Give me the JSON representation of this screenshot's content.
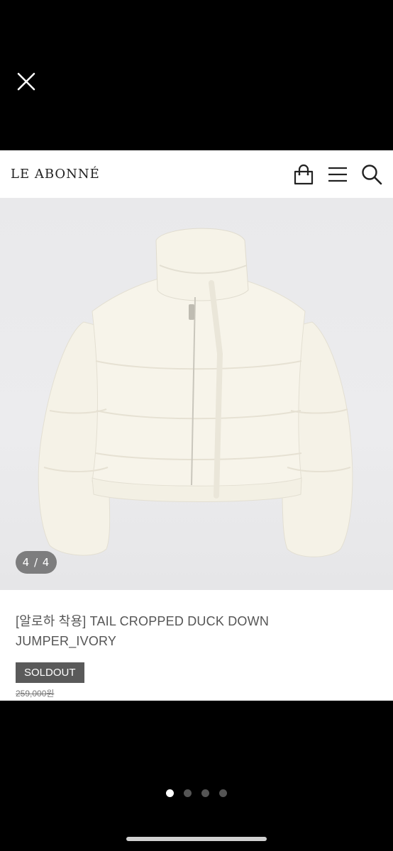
{
  "viewer": {
    "close_icon": "close-icon",
    "counter": "4 / 4",
    "pagination": {
      "total": 4,
      "active_index": 0
    }
  },
  "header": {
    "logo": "LE ABONNÉ",
    "icons": [
      "shopping-bag-icon",
      "menu-icon",
      "search-icon"
    ]
  },
  "product": {
    "title_line1": "[알로하 착용] TAIL CROPPED DUCK DOWN",
    "title_line2": "JUMPER_IVORY",
    "status_badge": "SOLDOUT",
    "original_price": "259,000원"
  },
  "colors": {
    "background": "#000000",
    "badge": "#5a5a5a",
    "jacket": "#f6f3e8"
  }
}
